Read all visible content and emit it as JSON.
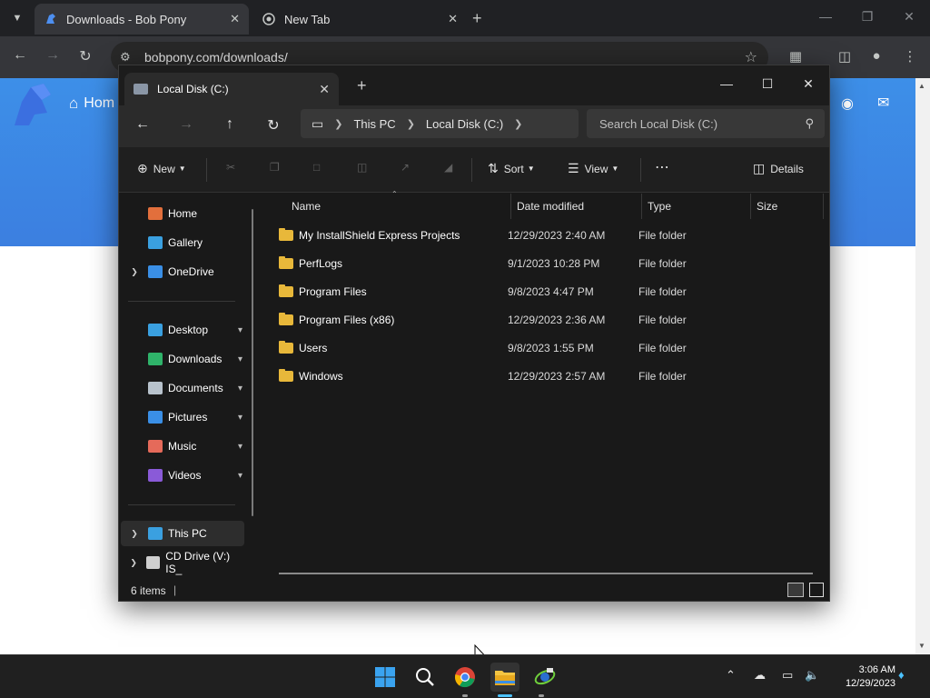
{
  "browser": {
    "tabs": [
      {
        "title": "Downloads - Bob Pony",
        "active": true
      },
      {
        "title": "New Tab",
        "active": false
      }
    ],
    "url": "bobpony.com/downloads/",
    "page_nav_text": "Hom"
  },
  "explorer": {
    "tab_title": "Local Disk (C:)",
    "breadcrumbs": [
      "This PC",
      "Local Disk (C:)"
    ],
    "search_placeholder": "Search Local Disk (C:)",
    "commands": {
      "new": "New",
      "sort": "Sort",
      "view": "View",
      "details": "Details"
    },
    "nav": {
      "top": [
        {
          "label": "Home",
          "icon": "home-icon",
          "color": "#e26f3c"
        },
        {
          "label": "Gallery",
          "icon": "gallery-icon",
          "color": "#3aa0e0"
        },
        {
          "label": "OneDrive",
          "icon": "onedrive-icon",
          "color": "#3a8fe6"
        }
      ],
      "pinned": [
        {
          "label": "Desktop",
          "icon": "desktop-icon",
          "color": "#3aa0e0"
        },
        {
          "label": "Downloads",
          "icon": "downloads-icon",
          "color": "#2fb36a"
        },
        {
          "label": "Documents",
          "icon": "documents-icon",
          "color": "#b8c2cc"
        },
        {
          "label": "Pictures",
          "icon": "pictures-icon",
          "color": "#3a8fe6"
        },
        {
          "label": "Music",
          "icon": "music-icon",
          "color": "#e56a5a"
        },
        {
          "label": "Videos",
          "icon": "videos-icon",
          "color": "#8a5ad8"
        }
      ],
      "bottom": [
        {
          "label": "This PC",
          "icon": "this-pc-icon",
          "color": "#3aa0e0"
        },
        {
          "label": "CD Drive (V:) IS_",
          "icon": "cd-drive-icon",
          "color": "#cfcfcf"
        }
      ]
    },
    "columns": [
      "Name",
      "Date modified",
      "Type",
      "Size"
    ],
    "files": [
      {
        "name": "My InstallShield Express Projects",
        "modified": "12/29/2023 2:40 AM",
        "type": "File folder"
      },
      {
        "name": "PerfLogs",
        "modified": "9/1/2023 10:28 PM",
        "type": "File folder"
      },
      {
        "name": "Program Files",
        "modified": "9/8/2023 4:47 PM",
        "type": "File folder"
      },
      {
        "name": "Program Files (x86)",
        "modified": "12/29/2023 2:36 AM",
        "type": "File folder"
      },
      {
        "name": "Users",
        "modified": "9/8/2023 1:55 PM",
        "type": "File folder"
      },
      {
        "name": "Windows",
        "modified": "12/29/2023 2:57 AM",
        "type": "File folder"
      }
    ],
    "status": "6 items"
  },
  "taskbar": {
    "time": "3:06 AM",
    "date": "12/29/2023"
  }
}
